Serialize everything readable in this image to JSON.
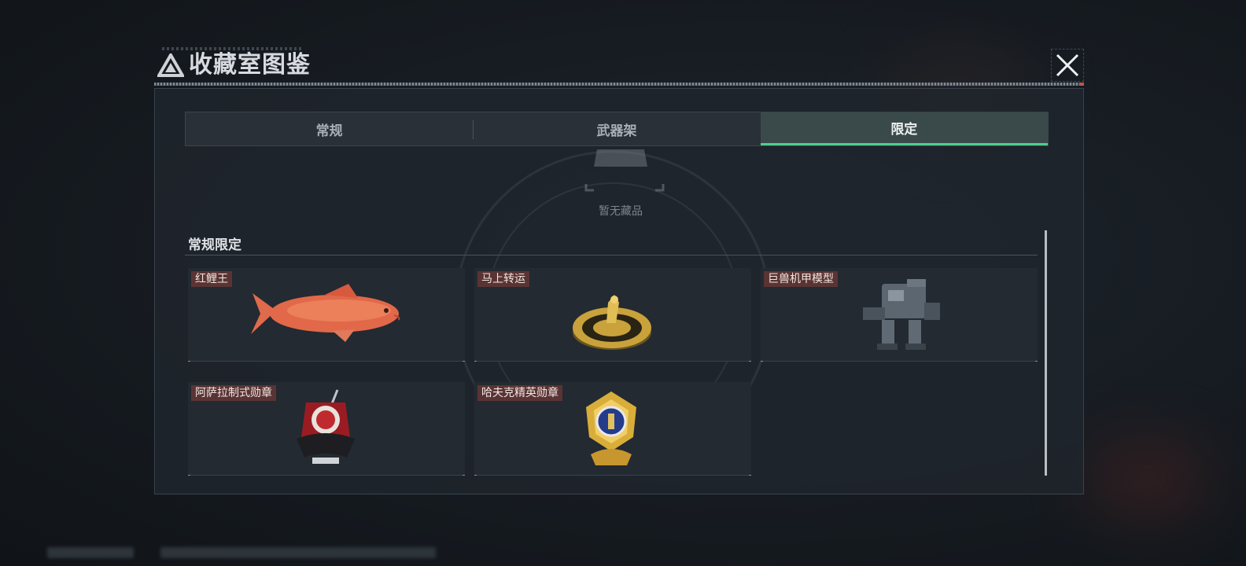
{
  "header": {
    "title": "收藏室图鉴"
  },
  "tabs": [
    {
      "label": "常规",
      "active": false
    },
    {
      "label": "武器架",
      "active": false
    },
    {
      "label": "限定",
      "active": true
    }
  ],
  "empty_state": {
    "text": "暂无藏品"
  },
  "section": {
    "title": "常规限定",
    "items": [
      {
        "label": "红鲤王",
        "icon": "red-carp-icon"
      },
      {
        "label": "马上转运",
        "icon": "golden-horse-dial-icon"
      },
      {
        "label": "巨兽机甲模型",
        "icon": "mech-model-icon"
      },
      {
        "label": "阿萨拉制式勋章",
        "icon": "red-medal-icon"
      },
      {
        "label": "哈夫克精英勋章",
        "icon": "gold-blue-medal-icon"
      }
    ]
  },
  "colors": {
    "accent": "#4fcf8e",
    "label_bg": "#5a3434",
    "panel_bg": "#20262d"
  }
}
